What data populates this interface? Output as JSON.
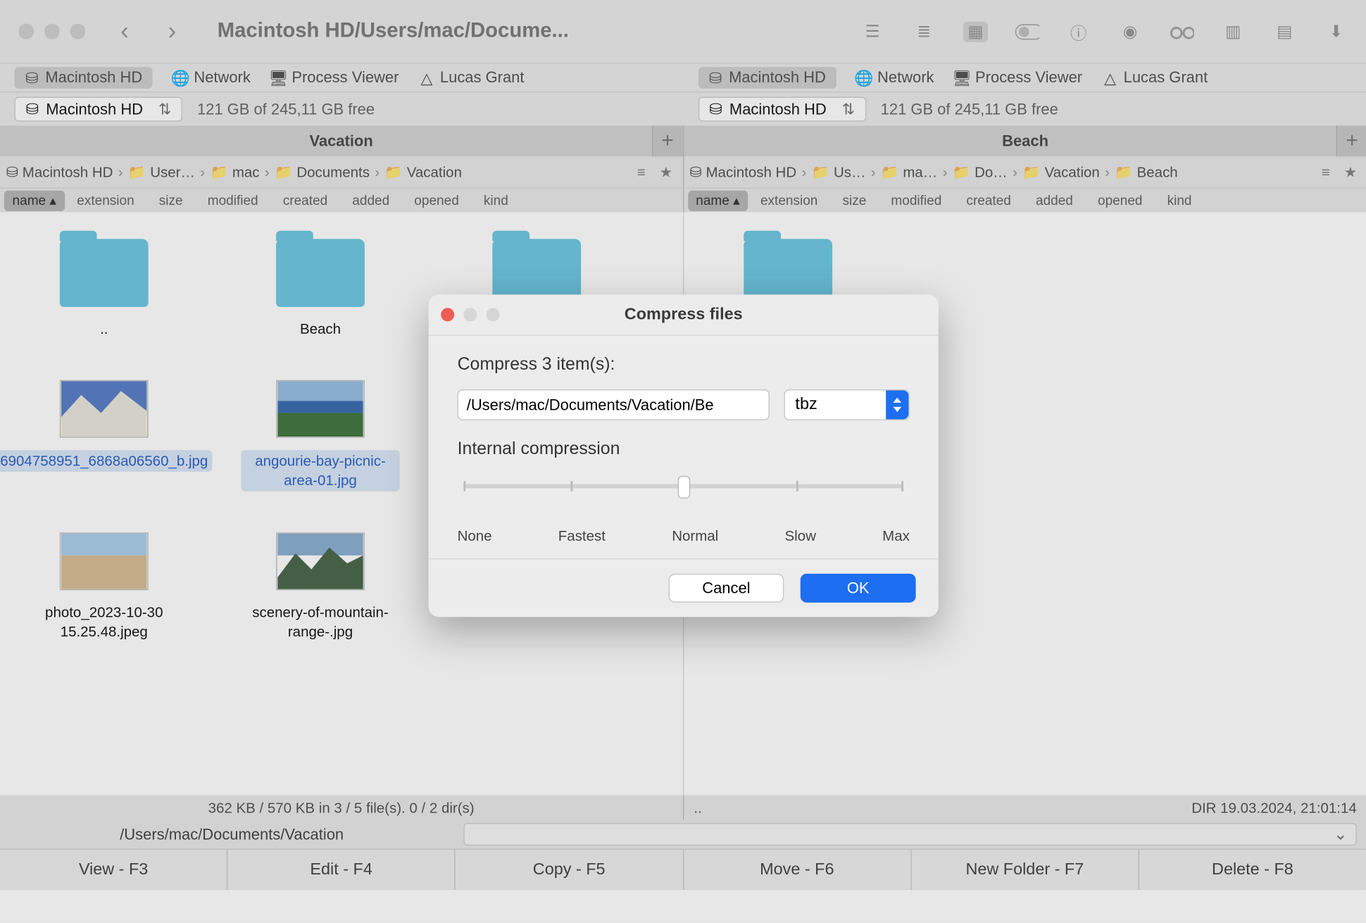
{
  "window": {
    "title_path": "Macintosh HD/Users/mac/Docume..."
  },
  "tabs": [
    {
      "label": "Macintosh HD",
      "active": true
    },
    {
      "label": "Network"
    },
    {
      "label": "Process Viewer"
    },
    {
      "label": "Lucas Grant"
    }
  ],
  "disk": {
    "name": "Macintosh HD",
    "free": "121 GB of 245,11 GB free"
  },
  "left": {
    "title": "Vacation",
    "breadcrumbs": [
      "Macintosh HD",
      "User…",
      "mac",
      "Documents",
      "Vacation"
    ],
    "columns": [
      "name",
      "extension",
      "size",
      "modified",
      "created",
      "added",
      "opened",
      "kind"
    ],
    "items": [
      {
        "name": "..",
        "type": "folder"
      },
      {
        "name": "Beach",
        "type": "folder"
      },
      {
        "name": "",
        "type": "folder"
      },
      {
        "name": "6904758951_6868a06560_b.jpg",
        "type": "image",
        "selected": true,
        "thumb": "mountain1"
      },
      {
        "name": "angourie-bay-picnic-area-01.jpg",
        "type": "image",
        "selected": true,
        "thumb": "beach1"
      },
      {
        "name": "",
        "type": "empty"
      },
      {
        "name": "photo_2023-10-30 15.25.48.jpeg",
        "type": "image",
        "thumb": "beachsand"
      },
      {
        "name": "scenery-of-mountain-range-.jpg",
        "type": "image",
        "thumb": "mountain2"
      }
    ],
    "status": "362 KB / 570 KB in 3 / 5 file(s). 0 / 2 dir(s)"
  },
  "right": {
    "title": "Beach",
    "breadcrumbs": [
      "Macintosh HD",
      "Us…",
      "ma…",
      "Do…",
      "Vacation",
      "Beach"
    ],
    "columns": [
      "name",
      "extension",
      "size",
      "modified",
      "created",
      "added",
      "opened",
      "kind"
    ],
    "items": [
      {
        "name": "",
        "type": "folder"
      }
    ],
    "status_left": "..",
    "status_right": "DIR   19.03.2024, 21:01:14"
  },
  "path_display": "/Users/mac/Documents/Vacation",
  "fkeys": [
    "View - F3",
    "Edit - F4",
    "Copy - F5",
    "Move - F6",
    "New Folder - F7",
    "Delete - F8"
  ],
  "dialog": {
    "title": "Compress files",
    "count_label": "Compress 3 item(s):",
    "path_value": "/Users/mac/Documents/Vacation/Be",
    "format": "tbz",
    "internal_label": "Internal compression",
    "slider_labels": [
      "None",
      "Fastest",
      "Normal",
      "Slow",
      "Max"
    ],
    "cancel": "Cancel",
    "ok": "OK"
  }
}
